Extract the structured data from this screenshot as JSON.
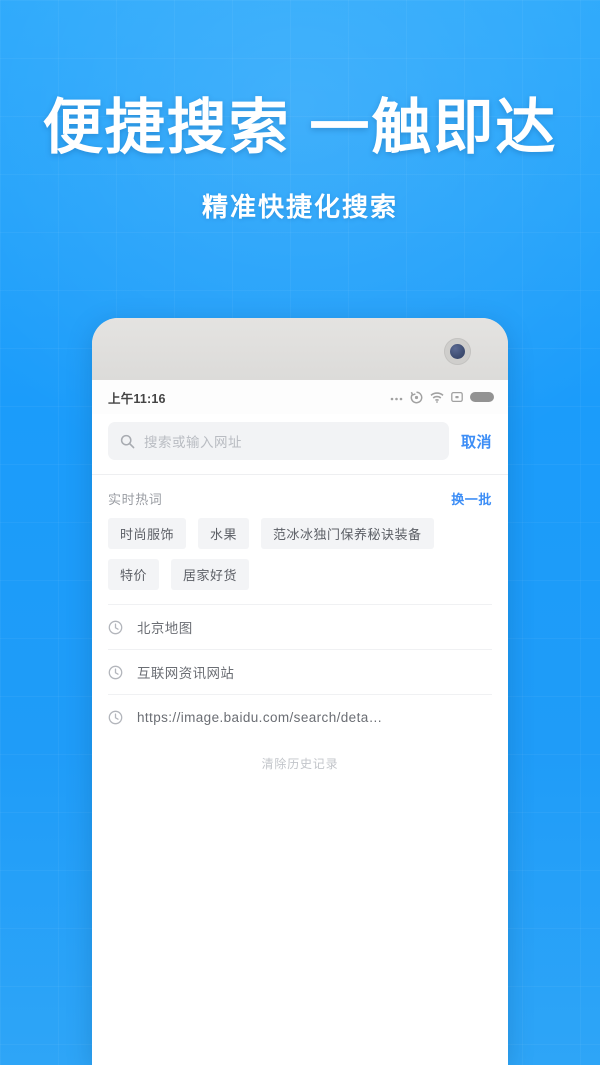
{
  "hero": {
    "title": "便捷搜索 一触即达",
    "subtitle": "精准快捷化搜索"
  },
  "phone": {
    "status_bar": {
      "time": "上午11:16",
      "icons": [
        "more-dots-icon",
        "sync-icon",
        "wifi-icon",
        "sim-icon",
        "battery-icon"
      ]
    },
    "search": {
      "placeholder": "搜索或输入网址",
      "value": "",
      "icon": "search-icon",
      "cancel_label": "取消"
    },
    "hot_words": {
      "section_title": "实时热词",
      "refresh_label": "换一批",
      "tags": [
        "时尚服饰",
        "水果",
        "范冰冰独门保养秘诀装备",
        "特价",
        "居家好货"
      ]
    },
    "history": {
      "items": [
        {
          "icon": "clock-icon",
          "text": "北京地图"
        },
        {
          "icon": "clock-icon",
          "text": "互联网资讯网站"
        },
        {
          "icon": "clock-icon",
          "text": "https://image.baidu.com/search/deta…"
        }
      ],
      "clear_label": "清除历史记录"
    }
  },
  "colors": {
    "background_blue": "#1b9cfa",
    "accent_link": "#3d8ef6",
    "tag_background": "#f3f4f6",
    "search_background": "#f2f3f5",
    "phone_bezel": "#dededc"
  }
}
